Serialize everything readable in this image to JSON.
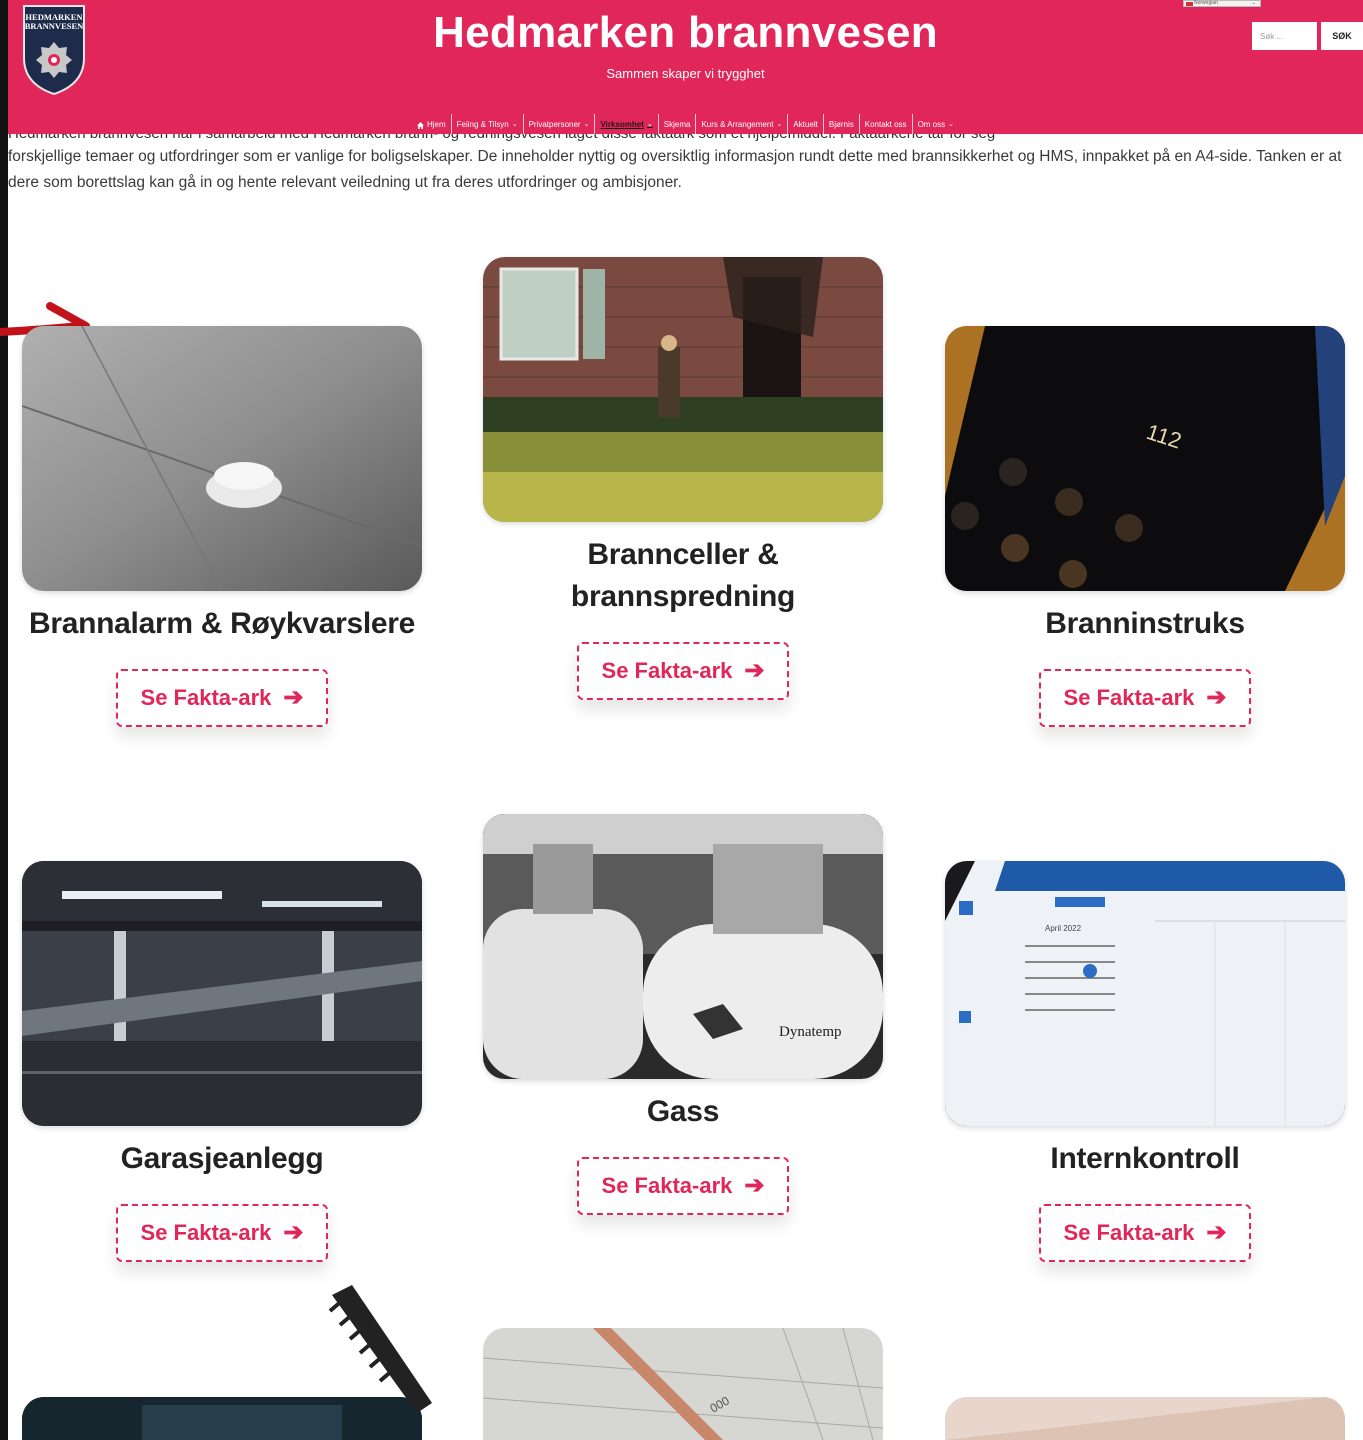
{
  "header": {
    "logo_text": "HEDMARKEN BRANNVESEN",
    "site_title": "Hedmarken brannvesen",
    "tagline": "Sammen skaper vi trygghet",
    "background_color": "#e1265a"
  },
  "language": {
    "selected": "Norwegian"
  },
  "search": {
    "placeholder": "Søk ...",
    "button_label": "SØK"
  },
  "nav": {
    "items": [
      {
        "label": "Hjem",
        "icon": "home-icon"
      },
      {
        "label": "Feiing & Tilsyn",
        "dropdown": true
      },
      {
        "label": "Privatpersoner",
        "dropdown": true
      },
      {
        "label": "Virksomhet",
        "dropdown": true,
        "active": true
      },
      {
        "label": "Skjema"
      },
      {
        "label": "Kurs & Arrangement",
        "dropdown": true
      },
      {
        "label": "Aktuelt"
      },
      {
        "label": "Bjørnis"
      },
      {
        "label": "Kontakt oss"
      },
      {
        "label": "Om oss",
        "dropdown": true
      }
    ]
  },
  "intro": {
    "hidden_line": "Hedmarken brannvesen har i samarbeid med Hedmarken brann- og redningsvesen laget disse faktaark som et hjelpemiddel. Faktaarkene tar for seg",
    "text": "forskjellige temaer og utfordringer som er vanlige for boligselskaper. De inneholder nyttig og oversiktlig informasjon rundt dette med brannsikkerhet og HMS, innpakket på en A4-side. Tanken er at dere som borettslag kan gå in og hente relevant veiledning ut fra deres utfordringer og ambisjoner."
  },
  "cards": [
    {
      "title": "Brannalarm & Røykvarslere",
      "button": "Se Fakta-ark",
      "image": "smoke-detector-photo"
    },
    {
      "title": "Brannceller & brannspredning",
      "button": "Se Fakta-ark",
      "image": "burned-house-photo"
    },
    {
      "title": "Branninstruks",
      "button": "Se Fakta-ark",
      "image": "phone-112-photo",
      "image_text": "112"
    },
    {
      "title": "Garasjeanlegg",
      "button": "Se Fakta-ark",
      "image": "parking-garage-photo"
    },
    {
      "title": "Gass",
      "button": "Se Fakta-ark",
      "image": "gas-cylinders-photo",
      "image_text": "Dynatemp"
    },
    {
      "title": "Internkontroll",
      "button": "Se Fakta-ark",
      "image": "calendar-screen-photo",
      "image_text": "April 2022"
    }
  ],
  "accent_color": "#e1265a"
}
